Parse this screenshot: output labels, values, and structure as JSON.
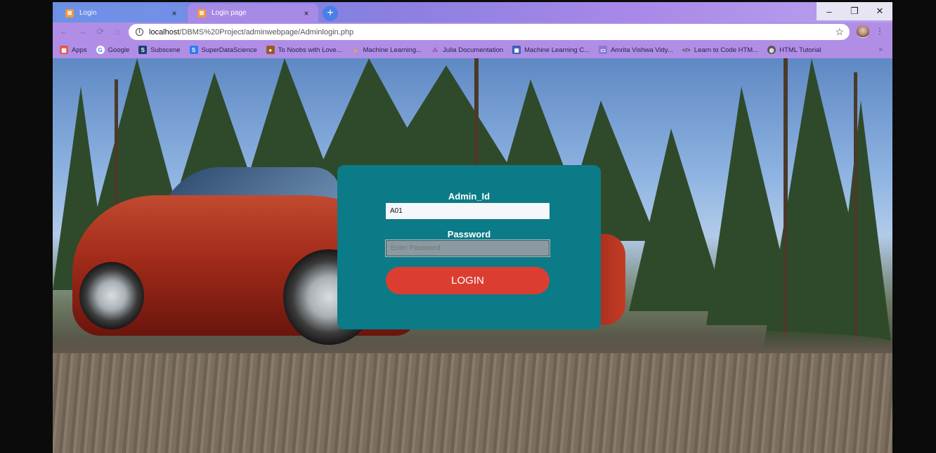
{
  "tabs": [
    {
      "title": "Login",
      "close": "×"
    },
    {
      "title": "Login page",
      "close": "×"
    }
  ],
  "new_tab": "+",
  "window_controls": {
    "minimize": "–",
    "maximize": "❐",
    "close": "✕"
  },
  "toolbar": {
    "back": "←",
    "forward": "→",
    "reload": "⟳",
    "home": "⌂",
    "url_host": "localhost",
    "url_path": "/DBMS%20Project/adminwebpage/Adminlogin.php",
    "star": "☆",
    "menu": "⋮"
  },
  "bookmarks": [
    {
      "label": "Apps",
      "icon": "apps-icon",
      "color": "#e2574c"
    },
    {
      "label": "Google",
      "icon": "google-icon",
      "color": "#4285f4"
    },
    {
      "label": "Subscene",
      "icon": "subscene-icon",
      "color": "#1b3f73"
    },
    {
      "label": "SuperDataScience",
      "icon": "superdatascience-icon",
      "color": "#2d7cf0"
    },
    {
      "label": "To Noobs with Love...",
      "icon": "noobs-icon",
      "color": "#9a5a1f"
    },
    {
      "label": "Machine Learning...",
      "icon": "drive-icon",
      "color": "#f4b400"
    },
    {
      "label": "Julia Documentation",
      "icon": "julia-icon",
      "color": "#9558b2"
    },
    {
      "label": "Machine Learning C...",
      "icon": "ml-course-icon",
      "color": "#3b5bb5"
    },
    {
      "label": "Amrita Vishwa Vidy...",
      "icon": "amrita-icon",
      "color": "#8a7ad0"
    },
    {
      "label": "Learn to Code HTM...",
      "icon": "code-icon",
      "color": "#444444"
    },
    {
      "label": "HTML Tutorial",
      "icon": "globe-icon",
      "color": "#555555"
    }
  ],
  "bookmarks_more": "»",
  "login": {
    "admin_label": "Admin_Id",
    "admin_value": "A01",
    "password_label": "Password",
    "password_placeholder": "Enter Password",
    "button": "LOGIN"
  },
  "colors": {
    "card": "#0b7b87",
    "button": "#db3e31"
  }
}
